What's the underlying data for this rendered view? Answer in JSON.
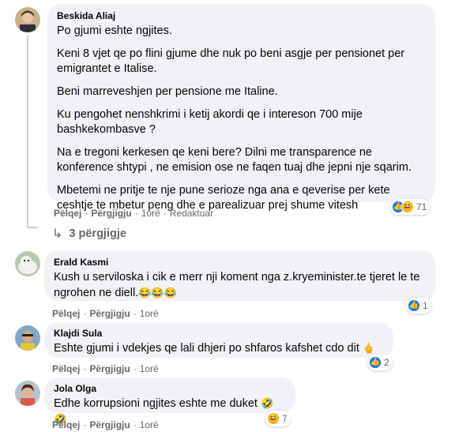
{
  "comments": [
    {
      "author": "Beskida Aliaj",
      "paragraphs": [
        "Po gjumi eshte ngjites.",
        "Keni 8 vjet qe po flini gjume dhe nuk po beni asgje per pensionet per emigrantet e Italise.",
        "Beni marreveshjen per pensione me Italine.",
        "Ku pengohet nenshkrimi i ketij akordi qe i intereson 700 mije bashkekombasve ?",
        "Na e tregoni kerkesen qe keni bere? Dilni me transparence ne konference shtypi , ne emision ose ne faqen tuaj dhe jepni nje sqarim.",
        "Mbetemi ne pritje te nje pune serioze nga ana e qeverise per kete ceshtje te mbetur peng dhe e parealizuar prej shume vitesh"
      ],
      "actions": {
        "like": "Pëlqej",
        "reply": "Përgjigju",
        "time": "1orë",
        "edited": "Redaktuar"
      },
      "reaction_count": "71",
      "replies_label": "3 përgjigje"
    },
    {
      "author": "Erald Kasmi",
      "text": "Kush u serviloska i cik e merr nji koment nga z.kryeminister.te tjeret le te ngrohen ne diell.",
      "emojis": "😂😂😂",
      "actions": {
        "like": "Pëlqej",
        "reply": "Përgjigju",
        "time": "1orë"
      },
      "reaction_count": "1"
    },
    {
      "author": "Klajdi Sula",
      "text": "Eshte gjumi i vdekjes qe lali dhjeri po shfaros kafshet cdo dit",
      "emojis": "🖕",
      "actions": {
        "like": "Pëlqej",
        "reply": "Përgjigju",
        "time": "1orë"
      },
      "reaction_count": "2"
    },
    {
      "author": "Jola Olga",
      "text": "Edhe korrupsioni ngjites eshte me duket",
      "emojis": "🤣🤣",
      "actions": {
        "like": "Pëlqej",
        "reply": "Përgjigju",
        "time": "1orë"
      },
      "reaction_count": "7"
    }
  ],
  "colors": {
    "bubble": "#f0f2f5",
    "meta": "#65676b",
    "like": "#1877f2"
  }
}
